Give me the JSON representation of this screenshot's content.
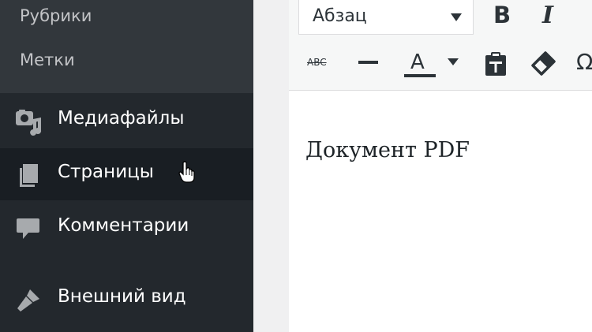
{
  "sidebar": {
    "submenu": [
      {
        "label": "Рубрики"
      },
      {
        "label": "Метки"
      }
    ],
    "items": [
      {
        "label": "Медиафайлы",
        "icon": "media-icon"
      },
      {
        "label": "Страницы",
        "icon": "pages-icon",
        "active": true
      },
      {
        "label": "Комментарии",
        "icon": "comments-icon"
      },
      {
        "label": "Внешний вид",
        "icon": "appearance-icon"
      }
    ]
  },
  "editor": {
    "toolbar": {
      "format_select": "Абзац",
      "bold": "B",
      "italic": "I",
      "strike": "ABC",
      "text_color": "A",
      "special_char": "Ω"
    },
    "content_text": "Документ PDF"
  },
  "colors": {
    "sidebar_bg": "#23282d",
    "submenu_bg": "#32373c",
    "active_item_bg": "#191e23",
    "toolbar_bg": "#f6f7f7"
  }
}
